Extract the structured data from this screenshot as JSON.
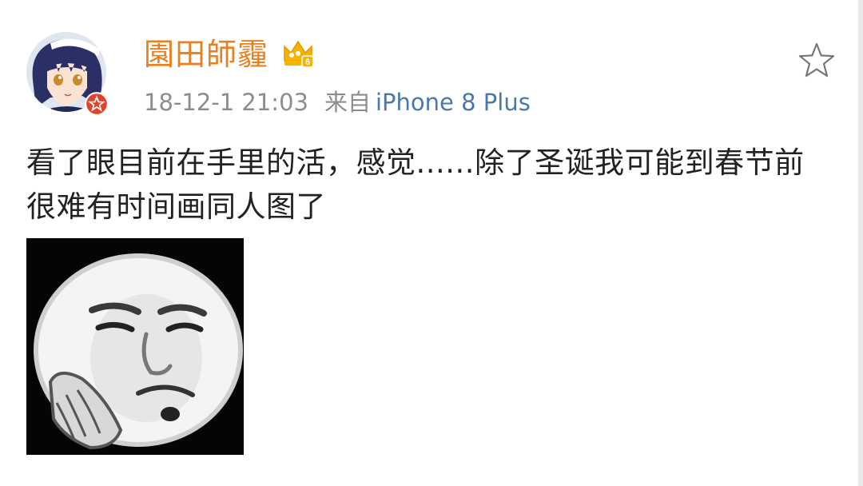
{
  "post": {
    "author": {
      "name": "園田師霾",
      "level_badge": "6"
    },
    "timestamp": "18-12-1 21:03",
    "via_label": "来自",
    "source": "iPhone 8 Plus",
    "text": "看了眼目前在手里的活，感觉......除了圣诞我可能到春节前很难有时间画同人图了"
  },
  "colors": {
    "username": "#e8801f",
    "source_link": "#4a78ad",
    "meta": "#8d8d8d",
    "text": "#222222",
    "verified_badge": "#e2412a"
  },
  "icons": {
    "crown": "crown-level-icon",
    "favorite": "star-outline-icon",
    "verified": "verified-star-badge-icon"
  }
}
